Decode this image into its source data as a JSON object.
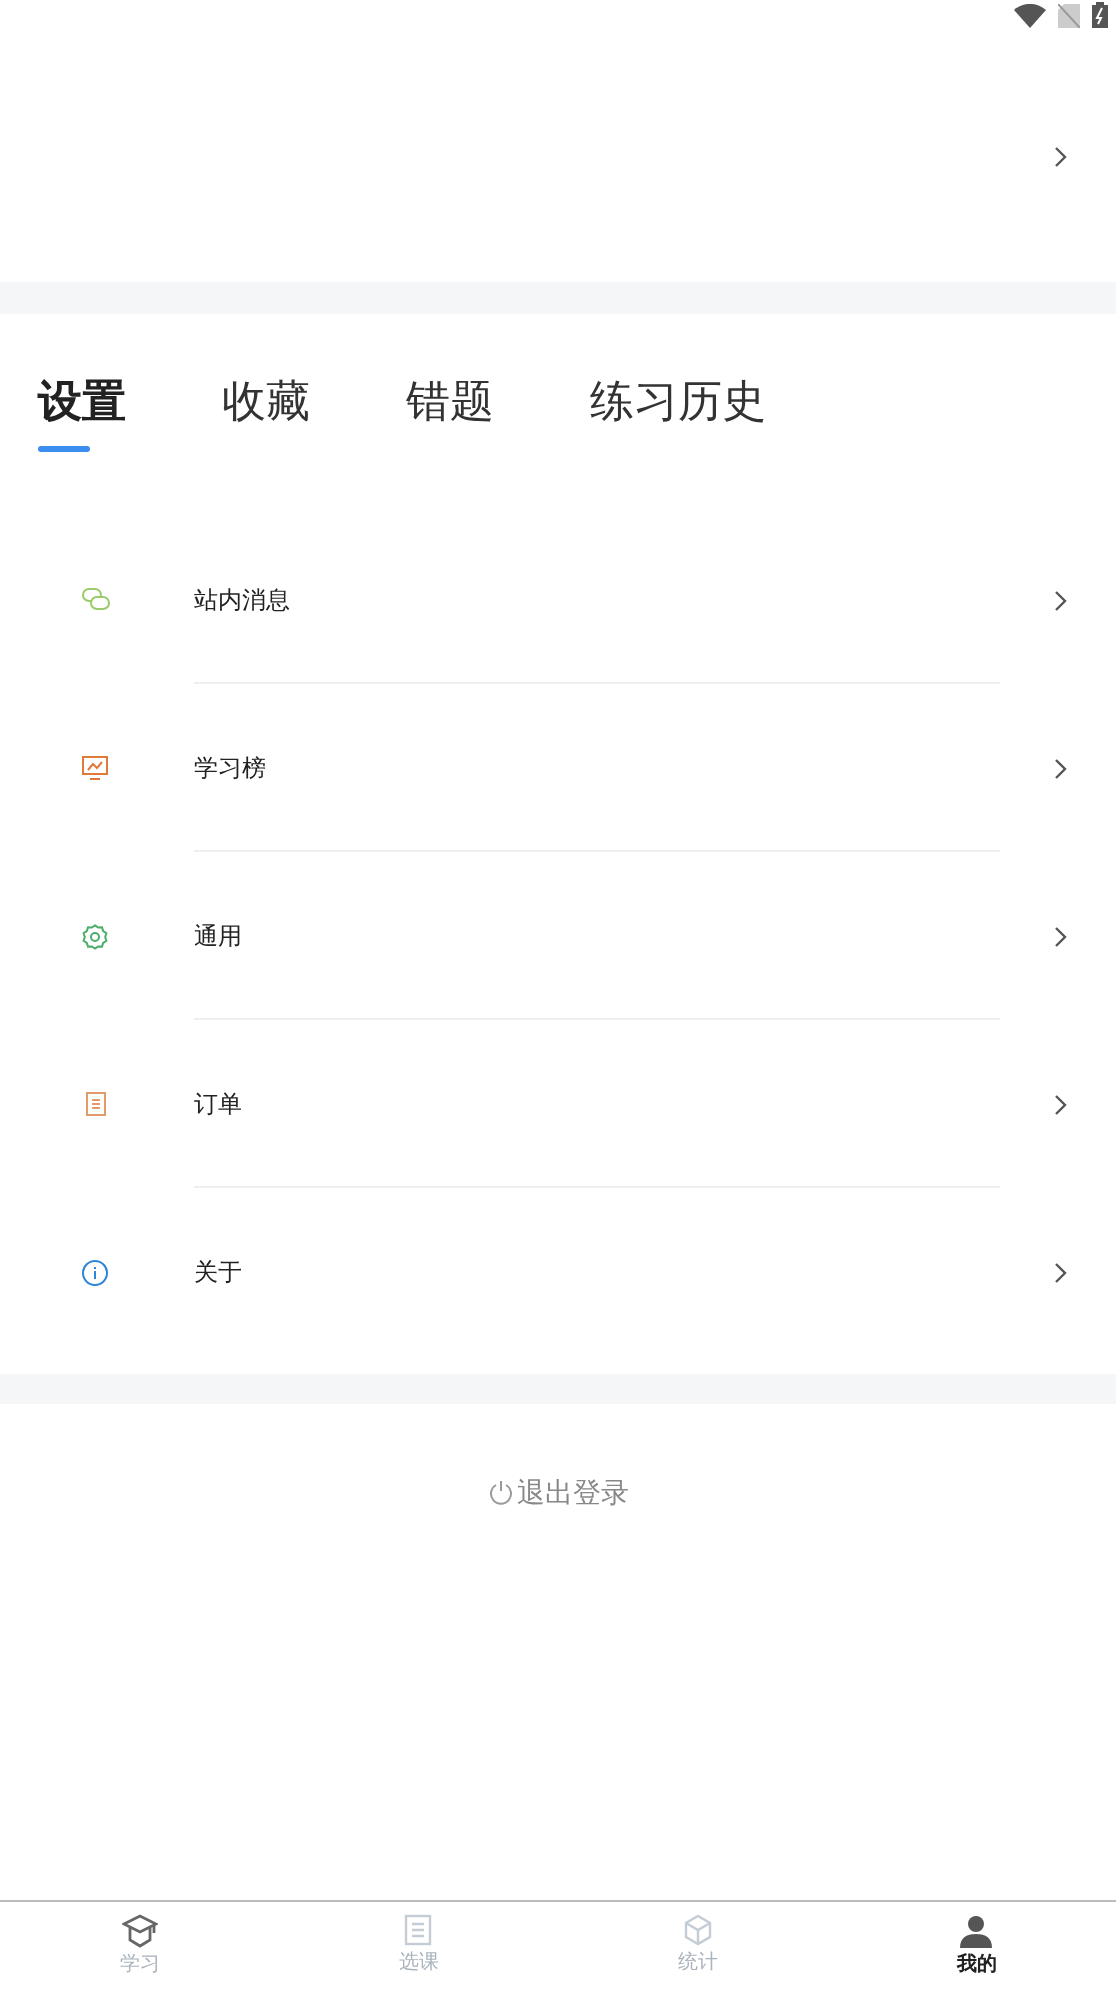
{
  "tabs": [
    {
      "label": "设置",
      "selected": true
    },
    {
      "label": "收藏",
      "selected": false
    },
    {
      "label": "错题",
      "selected": false
    },
    {
      "label": "练习历史",
      "selected": false
    }
  ],
  "menu": [
    {
      "label": "站内消息"
    },
    {
      "label": "学习榜"
    },
    {
      "label": "通用"
    },
    {
      "label": "订单"
    },
    {
      "label": "关于"
    }
  ],
  "logout": "退出登录",
  "bottom_nav": [
    {
      "label": "学习",
      "selected": false
    },
    {
      "label": "选课",
      "selected": false
    },
    {
      "label": "统计",
      "selected": false
    },
    {
      "label": "我的",
      "selected": true
    }
  ]
}
